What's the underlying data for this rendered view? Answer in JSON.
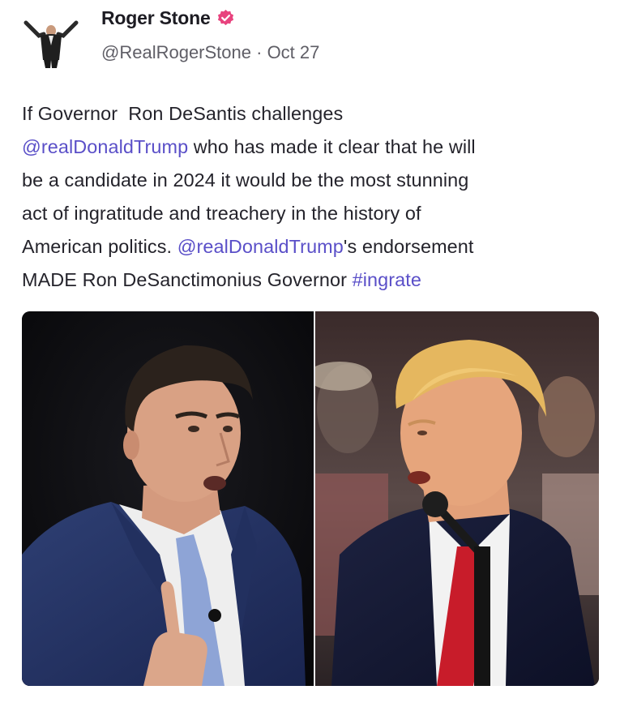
{
  "post": {
    "author": {
      "display_name": "Roger Stone",
      "handle": "@RealRogerStone",
      "separator": " · ",
      "date": "Oct 27",
      "verified_icon": "verified-badge-icon",
      "verified_color": "#e8437e"
    },
    "text": {
      "line1": "If Governor  Ron DeSantis challenges",
      "mention1": "@realDonaldTrump",
      "line2_rest": " who has made it clear that he will",
      "line3": "be a candidate in 2024 it would be the most stunning",
      "line4": "act of ingratitude and treachery in the history of",
      "line5_start": "American politics. ",
      "mention2": "@realDonaldTrump",
      "line5_rest": "'s endorsement",
      "line6_start": "MADE Ron DeSanctimonius Governor ",
      "hashtag": "#ingrate"
    },
    "media": {
      "left_image": "photo-desantis",
      "right_image": "photo-trump"
    },
    "colors": {
      "link": "#5a4fc8",
      "text": "#24232b",
      "meta": "#5f5e66"
    }
  }
}
